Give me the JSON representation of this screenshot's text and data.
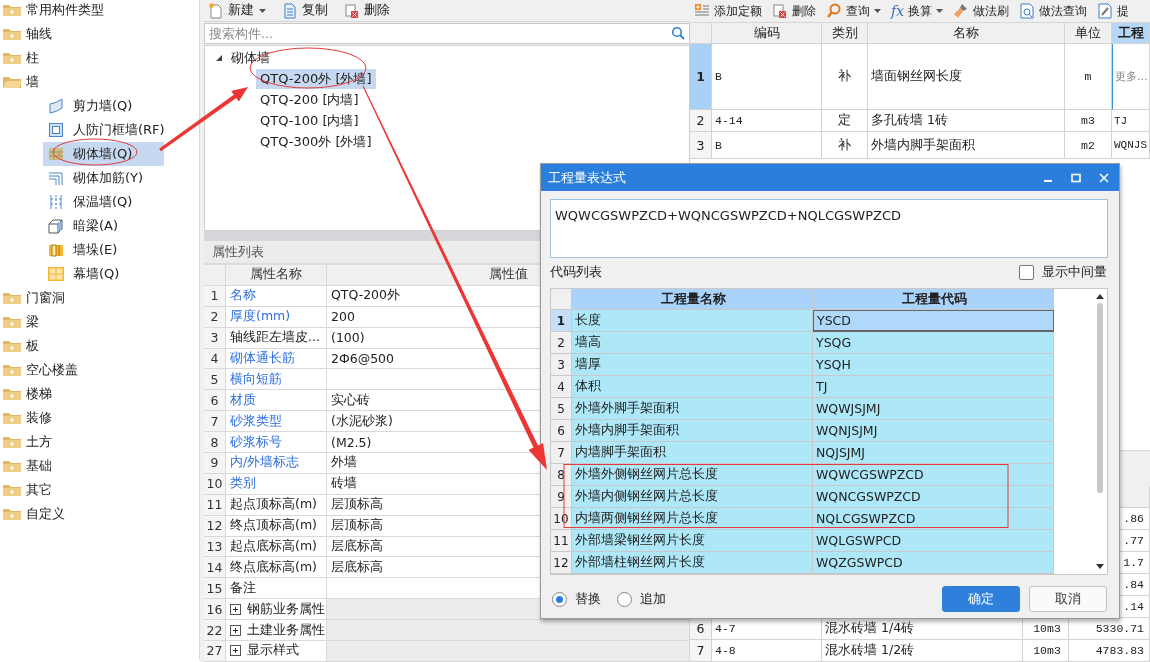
{
  "sidebar": {
    "items": [
      {
        "label": "常用构件类型",
        "expanded": false,
        "selected": false
      },
      {
        "label": "轴线",
        "expanded": false,
        "selected": false
      },
      {
        "label": "柱",
        "expanded": false,
        "selected": false
      },
      {
        "label": "墙",
        "expanded": true,
        "selected": false,
        "children": [
          {
            "label": "剪力墙(Q)",
            "selected": false
          },
          {
            "label": "人防门框墙(RF)",
            "selected": false
          },
          {
            "label": "砌体墙(Q)",
            "selected": true
          },
          {
            "label": "砌体加筋(Y)",
            "selected": false
          },
          {
            "label": "保温墙(Q)",
            "selected": false
          },
          {
            "label": "暗梁(A)",
            "selected": false
          },
          {
            "label": "墙垛(E)",
            "selected": false
          },
          {
            "label": "幕墙(Q)",
            "selected": false
          }
        ]
      },
      {
        "label": "门窗洞",
        "expanded": false,
        "selected": false
      },
      {
        "label": "梁",
        "expanded": false,
        "selected": false
      },
      {
        "label": "板",
        "expanded": false,
        "selected": false
      },
      {
        "label": "空心楼盖",
        "expanded": false,
        "selected": false
      },
      {
        "label": "楼梯",
        "expanded": false,
        "selected": false
      },
      {
        "label": "装修",
        "expanded": false,
        "selected": false
      },
      {
        "label": "土方",
        "expanded": false,
        "selected": false
      },
      {
        "label": "基础",
        "expanded": false,
        "selected": false
      },
      {
        "label": "其它",
        "expanded": false,
        "selected": false
      },
      {
        "label": "自定义",
        "expanded": false,
        "selected": false
      }
    ]
  },
  "component_panel": {
    "toolbar": [
      {
        "label": "新建",
        "dropdown": true
      },
      {
        "label": "复制",
        "dropdown": false
      },
      {
        "label": "删除",
        "dropdown": false
      }
    ],
    "search": {
      "placeholder": "搜索构件..."
    },
    "tree": {
      "label": "砌体墙",
      "expanded": true,
      "children": [
        {
          "label": "QTQ-200外 [外墙]",
          "selected": true
        },
        {
          "label": "QTQ-200 [内墙]",
          "selected": false
        },
        {
          "label": "QTQ-100 [内墙]",
          "selected": false
        },
        {
          "label": "QTQ-300外 [外墙]",
          "selected": false
        }
      ]
    }
  },
  "property_list": {
    "title": "属性列表",
    "columns": [
      "属性名称",
      "属性值"
    ],
    "rows": [
      {
        "kind": "property",
        "index": "1",
        "name": "名称",
        "value": "QTQ-200外",
        "public": true
      },
      {
        "kind": "property",
        "index": "2",
        "name": "厚度(mm)",
        "value": "200",
        "public": true
      },
      {
        "kind": "property",
        "index": "3",
        "name": "轴线距左墙皮...",
        "value": "(100)",
        "public": false
      },
      {
        "kind": "property",
        "index": "4",
        "name": "砌体通长筋",
        "value": "2Ф6@500",
        "public": true
      },
      {
        "kind": "property",
        "index": "5",
        "name": "横向短筋",
        "public": true
      },
      {
        "kind": "property",
        "index": "6",
        "name": "材质",
        "value": "实心砖",
        "public": true
      },
      {
        "kind": "property",
        "index": "7",
        "name": "砂浆类型",
        "value": "(水泥砂浆)",
        "public": true
      },
      {
        "kind": "property",
        "index": "8",
        "name": "砂浆标号",
        "value": "(M2.5)",
        "public": true
      },
      {
        "kind": "property",
        "index": "9",
        "name": "内/外墙标志",
        "value": "外墙",
        "public": true
      },
      {
        "kind": "property",
        "index": "10",
        "name": "类别",
        "value": "砖墙",
        "public": true
      },
      {
        "kind": "property",
        "index": "11",
        "name": "起点顶标高(m)",
        "value": "层顶标高",
        "public": false
      },
      {
        "kind": "property",
        "index": "12",
        "name": "终点顶标高(m)",
        "value": "层顶标高",
        "public": false
      },
      {
        "kind": "property",
        "index": "13",
        "name": "起点底标高(m)",
        "value": "层底标高",
        "public": false
      },
      {
        "kind": "property",
        "index": "14",
        "name": "终点底标高(m)",
        "value": "层底标高",
        "public": false
      },
      {
        "kind": "property",
        "index": "15",
        "name": "备注",
        "public": false
      },
      {
        "kind": "group",
        "index": "16",
        "name": "钢筋业务属性",
        "expanded": false
      },
      {
        "kind": "group",
        "index": "22",
        "name": "土建业务属性",
        "expanded": false
      },
      {
        "kind": "group",
        "index": "27",
        "name": "显示样式",
        "expanded": false
      }
    ]
  },
  "quota_panel": {
    "toolbar": [
      {
        "label": "添加定额",
        "dropdown": false
      },
      {
        "label": "删除",
        "dropdown": false
      },
      {
        "label": "查询",
        "dropdown": true
      },
      {
        "label": "换算",
        "dropdown": true,
        "icon_text": "fx"
      },
      {
        "label": "做法刷",
        "dropdown": false
      },
      {
        "label": "做法查询",
        "dropdown": false
      },
      {
        "label": "提",
        "dropdown": false
      }
    ],
    "columns": [
      "编码",
      "类别",
      "名称",
      "单位",
      "工程"
    ],
    "rows": [
      {
        "index": "1",
        "code": "B",
        "type": "补",
        "name": "墙面钢丝网长度",
        "unit": "m",
        "expression": "更多...",
        "selected": true
      },
      {
        "index": "2",
        "code": "4-14",
        "type": "定",
        "name": "多孔砖墙 1砖",
        "unit": "m3",
        "expression": "TJ",
        "selected": false
      },
      {
        "index": "3",
        "code": "B",
        "type": "补",
        "name": "外墙内脚手架面积",
        "unit": "m2",
        "expression": "WQNJS",
        "selected": false
      }
    ],
    "lower_rows": [
      {
        "value": ".86"
      },
      {
        "value": ".77"
      },
      {
        "value": "1.7"
      },
      {
        "value": ".84"
      },
      {
        "value": ".14"
      },
      {
        "index": "6",
        "code": "4-7",
        "name": "混水砖墙 1/4砖",
        "unit": "10m3",
        "value": "5330.71"
      },
      {
        "index": "7",
        "code": "4-8",
        "name": "混水砖墙 1/2砖",
        "unit": "10m3",
        "value": "4783.83"
      }
    ]
  },
  "dialog": {
    "title": "工程量表达式",
    "expression": "WQWCGSWPZCD+WQNCGSWPZCD+NQLCGSWPZCD",
    "code_list_label": "代码列表",
    "show_intermediate": {
      "label": "显示中间量",
      "checked": false
    },
    "columns": [
      "工程量名称",
      "工程量代码"
    ],
    "rows": [
      {
        "index": "1",
        "name": "长度",
        "code": "YSCD",
        "selected": true
      },
      {
        "index": "2",
        "name": "墙高",
        "code": "YSQG",
        "selected": false
      },
      {
        "index": "3",
        "name": "墙厚",
        "code": "YSQH",
        "selected": false
      },
      {
        "index": "4",
        "name": "体积",
        "code": "TJ",
        "selected": false
      },
      {
        "index": "5",
        "name": "外墙外脚手架面积",
        "code": "WQWJSJMJ",
        "selected": false
      },
      {
        "index": "6",
        "name": "外墙内脚手架面积",
        "code": "WQNJSJMJ",
        "selected": false
      },
      {
        "index": "7",
        "name": "内墙脚手架面积",
        "code": "NQJSJMJ",
        "selected": false
      },
      {
        "index": "8",
        "name": "外墙外侧钢丝网片总长度",
        "code": "WQWCGSWPZCD",
        "selected": false
      },
      {
        "index": "9",
        "name": "外墙内侧钢丝网片总长度",
        "code": "WQNCGSWPZCD",
        "selected": false
      },
      {
        "index": "10",
        "name": "内墙两侧钢丝网片总长度",
        "code": "NQLCGSWPZCD",
        "selected": false
      },
      {
        "index": "11",
        "name": "外部墙梁钢丝网片长度",
        "code": "WQLGSWPCD",
        "selected": false
      },
      {
        "index": "12",
        "name": "外部墙柱钢丝网片长度",
        "code": "WQZGSWPCD",
        "selected": false
      }
    ],
    "modes": [
      {
        "label": "替换",
        "selected": true
      },
      {
        "label": "追加",
        "selected": false
      }
    ],
    "buttons": [
      {
        "label": "确定",
        "kind": "primary"
      },
      {
        "label": "取消",
        "kind": "secondary"
      }
    ]
  }
}
